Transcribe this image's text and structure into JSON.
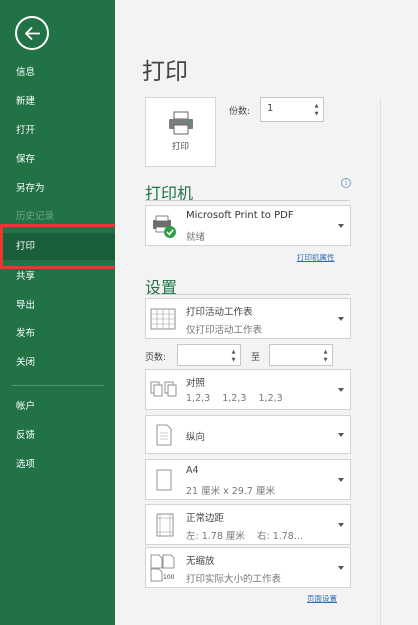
{
  "sidebar": {
    "items": [
      {
        "label": "信息"
      },
      {
        "label": "新建"
      },
      {
        "label": "打开"
      },
      {
        "label": "保存"
      },
      {
        "label": "另存为"
      },
      {
        "label": "历史记录"
      },
      {
        "label": "打印"
      },
      {
        "label": "共享"
      },
      {
        "label": "导出"
      },
      {
        "label": "发布"
      },
      {
        "label": "关闭"
      },
      {
        "label": "帐户"
      },
      {
        "label": "反馈"
      },
      {
        "label": "选项"
      }
    ],
    "active": "打印",
    "highlight_color": "#e53935",
    "background_color": "#217346"
  },
  "main": {
    "title": "打印",
    "print_button_label": "打印",
    "copies_label": "份数:",
    "copies_value": "1"
  },
  "printer": {
    "section_title": "打印机",
    "name": "Microsoft Print to PDF",
    "status": "就绪",
    "properties_link": "打印机属性"
  },
  "settings": {
    "section_title": "设置",
    "scope_title": "打印活动工作表",
    "scope_subtitle": "仅打印活动工作表",
    "pages_label": "页数:",
    "pages_to_label": "至",
    "collate_title": "对照",
    "collate_subtitle": "1,2,3    1,2,3    1,2,3",
    "orientation": "纵向",
    "paper_title": "A4",
    "paper_subtitle": "21 厘米 x 29.7 厘米",
    "margins_title": "正常边距",
    "margins_subtitle": "左: 1.78 厘米    右: 1.78...",
    "scaling_title": "无缩放",
    "scaling_subtitle": "打印实际大小的工作表",
    "page_setup_link": "页面设置"
  }
}
